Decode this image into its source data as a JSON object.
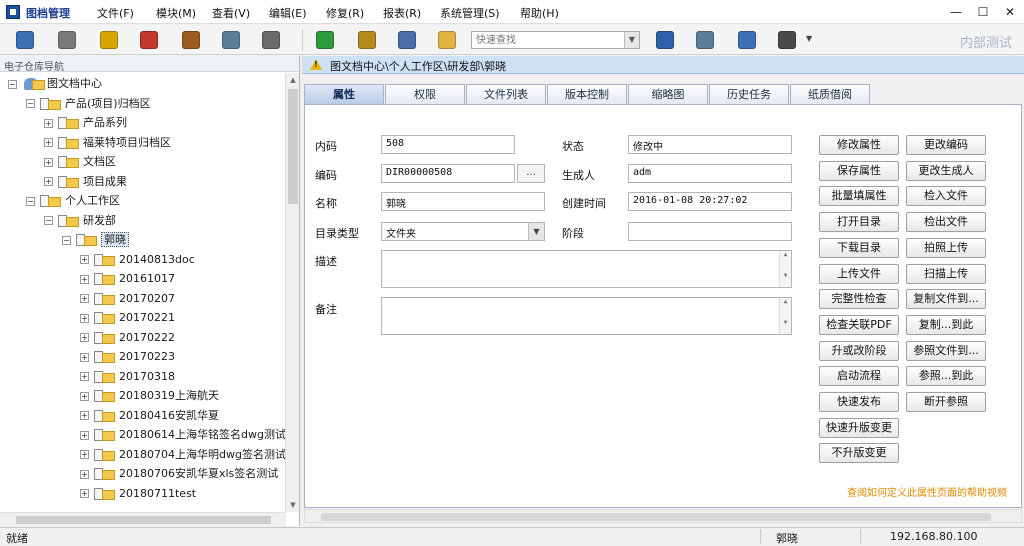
{
  "app": {
    "title": "图档管理"
  },
  "menu": [
    "文件(F)",
    "模块(M)",
    "查看(V)",
    "编辑(E)",
    "修复(R)",
    "报表(R)",
    "系统管理(S)",
    "帮助(H)"
  ],
  "window_controls": {
    "minimize": "—",
    "maximize": "☐",
    "close": "✕"
  },
  "toolbar": {
    "search_placeholder": "快速查找",
    "watermark": "内部测试",
    "icons": [
      "db-icon",
      "gear-icon",
      "eye-icon",
      "fill-icon",
      "hammer-icon",
      "doc-icon",
      "settings-icon",
      "refresh-icon",
      "print-icon",
      "magnify-icon",
      "folder-icon",
      "hierarchy-icon",
      "window-icon",
      "network-icon",
      "arrows-icon"
    ],
    "icon_colors": [
      "#3b6fb6",
      "#7a7a7a",
      "#d8a400",
      "#c0392b",
      "#9b5d1c",
      "#5b7f99",
      "#6a6a6a",
      "#2e9b3a",
      "#b58b1a",
      "#4a6fa8",
      "#e3b341",
      "#2f5fa8",
      "#5b7f99",
      "#3d6fb6",
      "#4a4a4a"
    ]
  },
  "left": {
    "header": "电子仓库导航",
    "tree": [
      {
        "label": "图文档中心",
        "level": 0,
        "toggle": "−",
        "type": "root"
      },
      {
        "label": "产品(项目)归档区",
        "level": 1,
        "toggle": "−",
        "type": "folder"
      },
      {
        "label": "产品系列",
        "level": 2,
        "toggle": "+",
        "type": "folder"
      },
      {
        "label": "福莱特项目归档区",
        "level": 2,
        "toggle": "+",
        "type": "folder"
      },
      {
        "label": "文档区",
        "level": 2,
        "toggle": "+",
        "type": "folder"
      },
      {
        "label": "项目成果",
        "level": 2,
        "toggle": "+",
        "type": "folder"
      },
      {
        "label": "个人工作区",
        "level": 1,
        "toggle": "−",
        "type": "folder"
      },
      {
        "label": "研发部",
        "level": 2,
        "toggle": "−",
        "type": "folder"
      },
      {
        "label": "郭晓",
        "level": 3,
        "toggle": "−",
        "type": "folder",
        "selected": true
      },
      {
        "label": "20140813doc",
        "level": 4,
        "toggle": "+",
        "type": "folder"
      },
      {
        "label": "20161017",
        "level": 4,
        "toggle": "+",
        "type": "folder"
      },
      {
        "label": "20170207",
        "level": 4,
        "toggle": "+",
        "type": "folder"
      },
      {
        "label": "20170221",
        "level": 4,
        "toggle": "+",
        "type": "folder"
      },
      {
        "label": "20170222",
        "level": 4,
        "toggle": "+",
        "type": "folder"
      },
      {
        "label": "20170223",
        "level": 4,
        "toggle": "+",
        "type": "folder"
      },
      {
        "label": "20170318",
        "level": 4,
        "toggle": "+",
        "type": "folder"
      },
      {
        "label": "20180319上海航天",
        "level": 4,
        "toggle": "+",
        "type": "folder"
      },
      {
        "label": "20180416安凯华夏",
        "level": 4,
        "toggle": "+",
        "type": "folder"
      },
      {
        "label": "20180614上海华铭签名dwg测试",
        "level": 4,
        "toggle": "+",
        "type": "folder"
      },
      {
        "label": "20180704上海华明dwg签名测试",
        "level": 4,
        "toggle": "+",
        "type": "folder"
      },
      {
        "label": "20180706安凯华夏xls签名测试",
        "level": 4,
        "toggle": "+",
        "type": "folder"
      },
      {
        "label": "20180711test",
        "level": 4,
        "toggle": "+",
        "type": "folder"
      }
    ]
  },
  "breadcrumb": "图文档中心\\个人工作区\\研发部\\郭晓",
  "tabs": [
    "属性",
    "权限",
    "文件列表",
    "版本控制",
    "缩略图",
    "历史任务",
    "纸质借阅"
  ],
  "active_tab": 0,
  "form": {
    "neima_label": "内码",
    "neima": "508",
    "biama_label": "编码",
    "biama": "DIR00000508",
    "ellipsis": "...",
    "name_label": "名称",
    "name": "郭晓",
    "type_label": "目录类型",
    "type": "文件夹",
    "dropdown_arrow": "▼",
    "status_label": "状态",
    "status": "修改中",
    "creator_label": "生成人",
    "creator": "adm",
    "created_label": "创建时间",
    "created": "2016-01-08 20:27:02",
    "stage_label": "阶段",
    "stage": "",
    "desc_label": "描述",
    "desc": "",
    "note_label": "备注",
    "note": ""
  },
  "buttons": {
    "left": [
      "修改属性",
      "保存属性",
      "批量填属性",
      "打开目录",
      "下载目录",
      "上传文件",
      "完整性检查",
      "检查关联PDF",
      "升或改阶段",
      "启动流程",
      "快速发布",
      "快速升版变更",
      "不升版变更"
    ],
    "right": [
      "更改编码",
      "更改生成人",
      "检入文件",
      "检出文件",
      "拍照上传",
      "扫描上传",
      "复制文件到...",
      "复制...到此",
      "参照文件到...",
      "参照...到此",
      "断开参照"
    ]
  },
  "help_link": "查阅如何定义此属性页面的帮助视频",
  "status": {
    "left": "就绪",
    "user": "郭晓",
    "ip": "192.168.80.100"
  }
}
